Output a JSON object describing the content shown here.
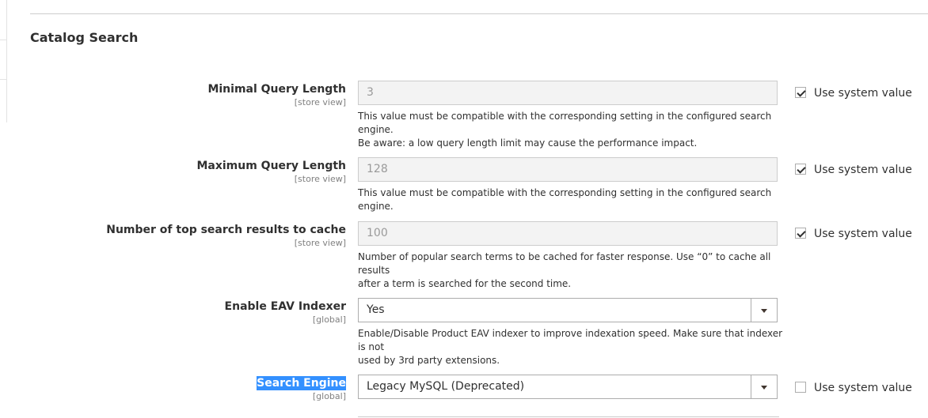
{
  "section": {
    "title": "Catalog Search"
  },
  "fields": [
    {
      "label": "Minimal Query Length",
      "scope": "[store view]",
      "value": "3",
      "note_lines": [
        "This value must be compatible with the corresponding setting in the configured search engine.",
        "Be aware: a low query length limit may cause the performance impact."
      ],
      "use_system_value": true,
      "use_system_label": "Use system value"
    },
    {
      "label": "Maximum Query Length",
      "scope": "[store view]",
      "value": "128",
      "note_lines": [
        "This value must be compatible with the corresponding setting in the configured search engine."
      ],
      "use_system_value": true,
      "use_system_label": "Use system value"
    },
    {
      "label": "Number of top search results to cache",
      "scope": "[store view]",
      "value": "100",
      "note_lines": [
        "Number of popular search terms to be cached for faster response. Use “0” to cache all results",
        "after a term is searched for the second time."
      ],
      "use_system_value": true,
      "use_system_label": "Use system value"
    },
    {
      "label": "Enable EAV Indexer",
      "scope": "[global]",
      "value": "Yes",
      "note_lines": [
        "Enable/Disable Product EAV indexer to improve indexation speed. Make sure that indexer is not",
        "used by 3rd party extensions."
      ]
    },
    {
      "label": "Search Engine",
      "scope": "[global]",
      "value": "Legacy MySQL (Deprecated)",
      "use_system_value": false,
      "use_system_label": "Use system value"
    }
  ]
}
